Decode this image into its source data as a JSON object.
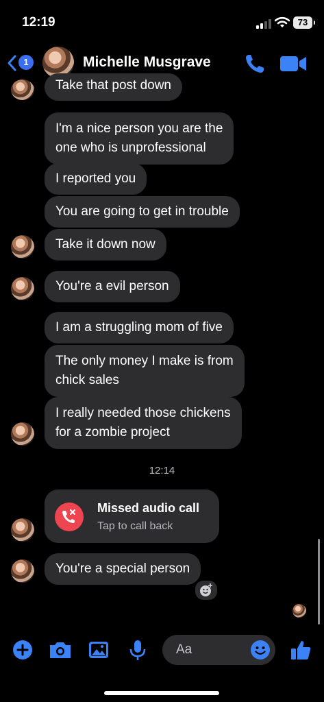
{
  "status_bar": {
    "time": "12:19",
    "battery": "73"
  },
  "header": {
    "back_count": "1",
    "contact_name": "Michelle Musgrave"
  },
  "messages": [
    {
      "text": "Take that post down"
    },
    {
      "text": "I'm a nice person you are the one who is unprofessional",
      "line1": "I'm a nice person you are the",
      "line2": "one who is unprofessional"
    },
    {
      "text": "I reported you"
    },
    {
      "text": "You are going to get in trouble"
    },
    {
      "text": "Take it down now"
    },
    {
      "text": "You're a evil person"
    },
    {
      "text": "I am a struggling mom of five"
    },
    {
      "text": "The only money I make is from chick sales",
      "line1": "The only money I make is from",
      "line2": "chick sales"
    },
    {
      "text": "I really needed those chickens for a zombie project",
      "line1": "I really needed those chickens",
      "line2": "for a zombie project"
    }
  ],
  "timestamp": "12:14",
  "missed_call": {
    "title": "Missed audio call",
    "subtitle": "Tap to call back"
  },
  "last_message": {
    "text": "You're a special person"
  },
  "composer": {
    "placeholder": "Aa"
  },
  "colors": {
    "accent": "#3b82f6",
    "bubble": "#2d2d2f",
    "missed_call": "#ef4550"
  },
  "icons": [
    "plus-icon",
    "camera-icon",
    "image-icon",
    "microphone-icon",
    "emoji-icon",
    "thumbs-up-icon",
    "phone-icon",
    "video-icon",
    "chevron-left-icon"
  ]
}
